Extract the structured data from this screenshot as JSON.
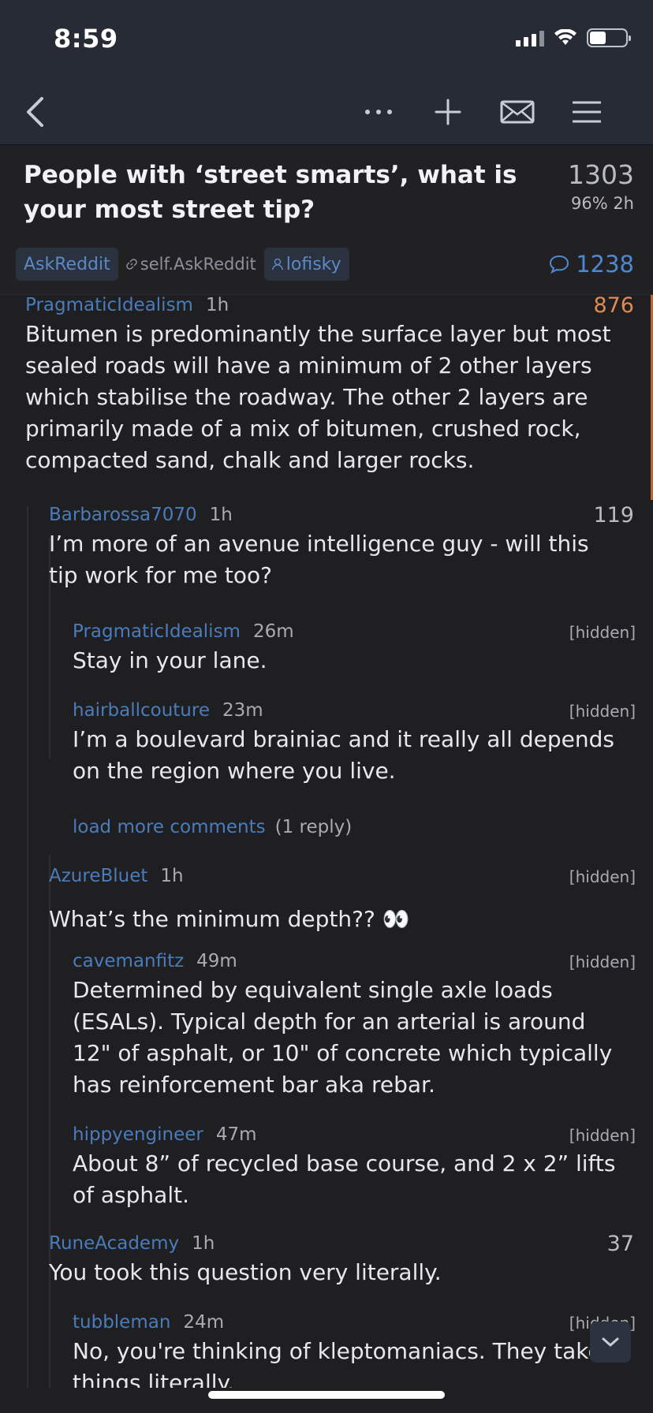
{
  "status_bar": {
    "time": "8:59"
  },
  "nav": {
    "back_icon": "chevron-left-icon",
    "more_icon": "ellipsis-icon",
    "add_icon": "plus-icon",
    "inbox_icon": "envelope-icon",
    "menu_icon": "hamburger-icon"
  },
  "post": {
    "title": "People with ‘street smarts’, what is your most street tip?",
    "score": "1303",
    "meta": "96% 2h",
    "subreddit": "AskReddit",
    "domain": "self.AskReddit",
    "author": "lofisky",
    "comment_count": "1238"
  },
  "comments": [
    {
      "author": "PragmaticIdealism",
      "age": "1h",
      "score": "876",
      "body": "Bitumen is predominantly the surface layer but most sealed roads will have a minimum of 2 other layers which stabilise the roadway. The other 2 layers are primarily made of a mix of bitumen, crushed rock, compacted sand, chalk and larger rocks."
    },
    {
      "author": "Barbarossa7070",
      "age": "1h",
      "score": "119",
      "body": "I’m more of an avenue intelligence guy - will this tip work for me too?"
    },
    {
      "author": "PragmaticIdealism",
      "age": "26m",
      "score": "[hidden]",
      "body": "Stay in your lane."
    },
    {
      "author": "hairballcouture",
      "age": "23m",
      "score": "[hidden]",
      "body": "I’m a boulevard brainiac and it really all depends on the region where you live."
    },
    {
      "author": "AzureBluet",
      "age": "1h",
      "score": "[hidden]",
      "body": "What’s the minimum depth?? 👀"
    },
    {
      "author": "cavemanfitz",
      "age": "49m",
      "score": "[hidden]",
      "body": "Determined by equivalent single axle loads (ESALs). Typical depth for an arterial is around 12\" of asphalt, or 10\" of concrete which typically has reinforcement bar aka rebar."
    },
    {
      "author": "hippyengineer",
      "age": "47m",
      "score": "[hidden]",
      "body": "About 8” of recycled base course, and 2 x 2” lifts of asphalt."
    },
    {
      "author": "RuneAcademy",
      "age": "1h",
      "score": "37",
      "body": "You took this question very literally."
    },
    {
      "author": "tubbleman",
      "age": "24m",
      "score": "[hidden]",
      "body": "No, you're thinking of kleptomaniacs. They take things literally."
    }
  ],
  "load_more": {
    "label": "load more comments",
    "count": "(1 reply)"
  },
  "colors": {
    "accent": "#4a7cbb",
    "score_hot": "#e08a52",
    "bg": "#1f1f21",
    "bar_bg": "#262b35"
  }
}
